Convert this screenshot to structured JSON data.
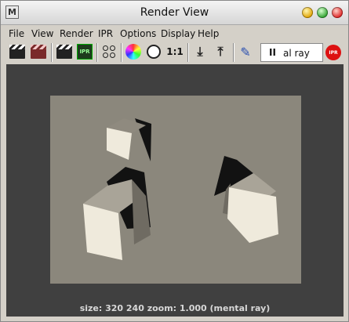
{
  "window": {
    "title": "Render View",
    "app_icon": "maya-logo-icon",
    "controls": [
      "minimize-icon",
      "maximize-icon",
      "close-icon"
    ]
  },
  "menubar": {
    "items": [
      "File",
      "View",
      "Render",
      "IPR",
      "Options",
      "Display",
      "Help"
    ]
  },
  "toolbar": {
    "icons": [
      "render-clapper-icon",
      "redo-render-clapper-icon",
      "ipr-render-clapper-icon",
      "ipr-icon",
      "render-settings-icon",
      "rgb-channels-icon",
      "alpha-channel-icon",
      "zoom-one-to-one-icon",
      "keep-image-icon",
      "remove-image-icon",
      "render-diagnostics-icon",
      "pause-icon",
      "ipr-stop-icon"
    ],
    "ipr_label": "IPR",
    "zoom_label": "1:1",
    "pause_label": "II",
    "renderer_value": "al ray",
    "stop_label": "IPR"
  },
  "render": {
    "status": "size:  320  240 zoom: 1.000  (mental ray)",
    "colors": {
      "viewport_bg": "#404040",
      "image_bg": "#8b877c",
      "cube_light": "#efeadc",
      "cube_mid": "#a9a498",
      "cube_dark": "#6f6b62",
      "shadow": "#121212"
    }
  }
}
